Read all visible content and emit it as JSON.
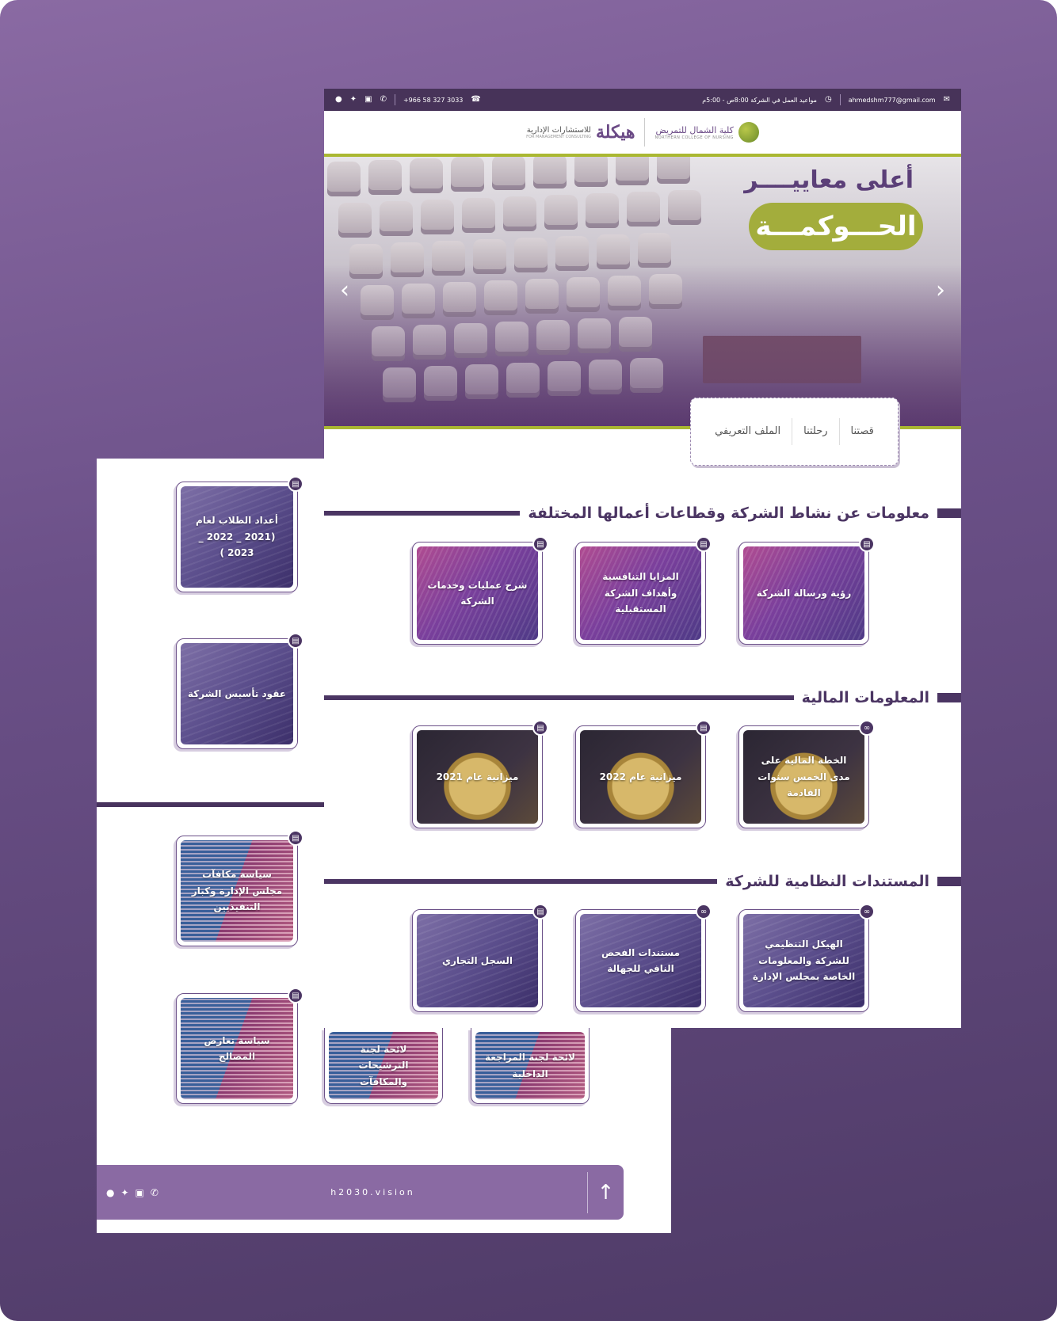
{
  "topbar": {
    "email": "ahmedshm777@gmail.com",
    "hours": "مواعيد العمل في الشركة 8:00ص - 5:00م",
    "phone": "+966 58 327 3033",
    "social_icons": [
      "whatsapp-icon",
      "instagram-icon",
      "twitter-icon",
      "snapchat-icon"
    ]
  },
  "logos": {
    "college_ar": "كلية الشمال للتمريض",
    "college_en": "NORTHERN COLLEGE OF NURSING",
    "consult_mark": "هيكلة",
    "consult_ar": "للاستشارات الإدارية",
    "consult_en": "FOR MANAGEMENT CONSULTING"
  },
  "hero": {
    "line1": "أعلى معاييــــر",
    "line2": "الحـــوكمـــة",
    "prev_icon": "‹",
    "next_icon": "›"
  },
  "tabs": [
    "قصتنا",
    "رحلتنا",
    "الملف التعريفي"
  ],
  "sections": [
    {
      "title": "معلومات عن نشاط الشركة وقطاعات أعمالها المختلفة",
      "cards": [
        "رؤية ورسالة الشركة",
        "المزايا التنافسية وأهداف الشركة المستقبلية",
        "شرح عمليات وخدمات الشركة"
      ]
    },
    {
      "title": "المعلومات المالية",
      "cards": [
        "الخطة المالية على مدى الخمس سنوات القادمة",
        "ميزانية عام 2022",
        "ميزانية عام 2021"
      ]
    },
    {
      "title": "المستندات النظامية للشركة",
      "cards": [
        "الهيكل التنظيمي للشركة والمعلومات الخاصة بمجلس الإدارة",
        "مستندات الفحص النافي للجهالة",
        "السجل التجاري"
      ]
    }
  ],
  "back_cards": [
    "أعداد الطلاب لعام (2021 _ 2022 _ 2023 )",
    "عقود تأسيس الشركة",
    "سياسة مكافآت مجلس الإدارة وكبار التنفيذيين",
    "سياسة تعارض المصالح",
    "لائحة لجنة الترشيحات والمكافآت",
    "لائحة لجنة المراجعة الداخلية"
  ],
  "footer": {
    "site": "h2030.vision",
    "up_icon": "↑",
    "social_icons": [
      "whatsapp-icon",
      "instagram-icon",
      "twitter-icon",
      "snapchat-icon"
    ]
  },
  "colors": {
    "brand_purple": "#4b3563",
    "accent_green": "#aab832",
    "footer_purple": "#8a6aa3"
  }
}
